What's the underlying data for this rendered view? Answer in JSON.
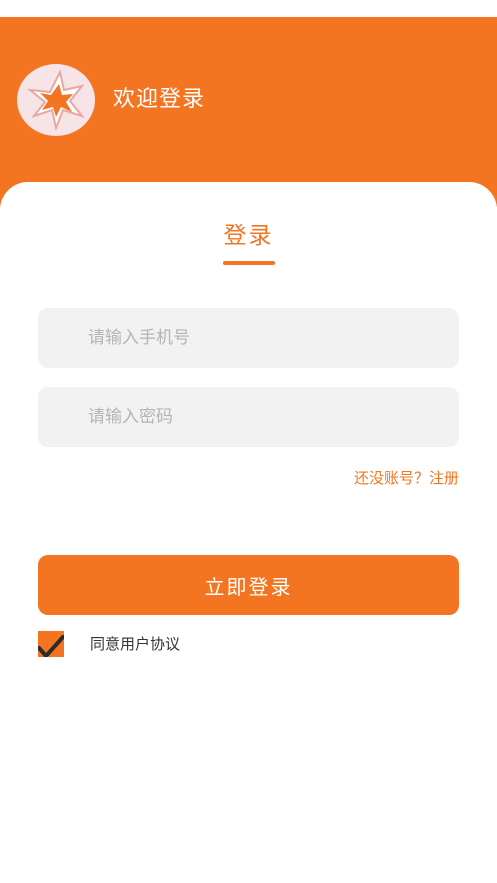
{
  "header": {
    "welcome_text": "欢迎登录",
    "logo_icon": "star-burst-logo-icon"
  },
  "tab": {
    "title": "登录"
  },
  "form": {
    "phone_placeholder": "请输入手机号",
    "password_placeholder": "请输入密码",
    "register_link": "还没账号？注册",
    "login_button": "立即登录",
    "agree_label": "同意用户协议",
    "agree_checked": true
  },
  "colors": {
    "accent": "#f47521",
    "input_bg": "#f2f2f2",
    "placeholder": "#b4b4b4",
    "logo_bg": "#f6e4e6"
  }
}
